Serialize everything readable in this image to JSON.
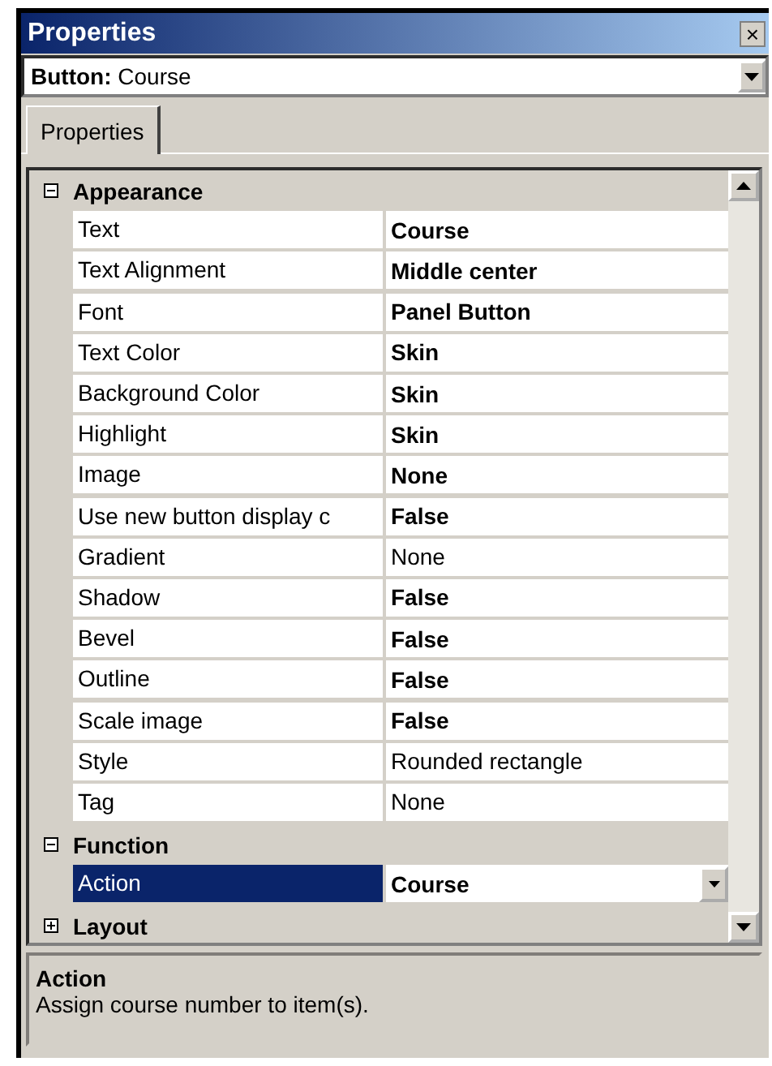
{
  "window": {
    "title": "Properties",
    "close": "×"
  },
  "object_selector": {
    "type": "Button:",
    "name": "Course"
  },
  "tabs": [
    {
      "label": "Properties",
      "selected": true
    }
  ],
  "groups": [
    {
      "label": "Appearance",
      "expanded": true,
      "rows": [
        {
          "name": "Text",
          "value": "Course",
          "bold": true,
          "selected": false
        },
        {
          "name": "Text Alignment",
          "value": "Middle center",
          "bold": true,
          "selected": false
        },
        {
          "name": "Font",
          "value": "Panel Button",
          "bold": true,
          "selected": false
        },
        {
          "name": "Text Color",
          "value": "Skin",
          "bold": true,
          "selected": false
        },
        {
          "name": "Background Color",
          "value": "Skin",
          "bold": true,
          "selected": false
        },
        {
          "name": "Highlight",
          "value": "Skin",
          "bold": true,
          "selected": false
        },
        {
          "name": "Image",
          "value": "None",
          "bold": true,
          "selected": false
        },
        {
          "name": "Use new button display c",
          "value": "False",
          "bold": true,
          "selected": false
        },
        {
          "name": "Gradient",
          "value": "None",
          "bold": false,
          "selected": false
        },
        {
          "name": "Shadow",
          "value": "False",
          "bold": true,
          "selected": false
        },
        {
          "name": "Bevel",
          "value": "False",
          "bold": true,
          "selected": false
        },
        {
          "name": "Outline",
          "value": "False",
          "bold": true,
          "selected": false
        },
        {
          "name": "Scale image",
          "value": "False",
          "bold": true,
          "selected": false
        },
        {
          "name": "Style",
          "value": "Rounded rectangle",
          "bold": false,
          "selected": false
        },
        {
          "name": "Tag",
          "value": "None",
          "bold": false,
          "selected": false
        }
      ]
    },
    {
      "label": "Function",
      "expanded": true,
      "rows": [
        {
          "name": "Action",
          "value": "Course",
          "bold": true,
          "selected": true
        }
      ]
    },
    {
      "label": "Layout",
      "expanded": false
    }
  ],
  "description": {
    "title": "Action",
    "text": "Assign course number to item(s)."
  }
}
